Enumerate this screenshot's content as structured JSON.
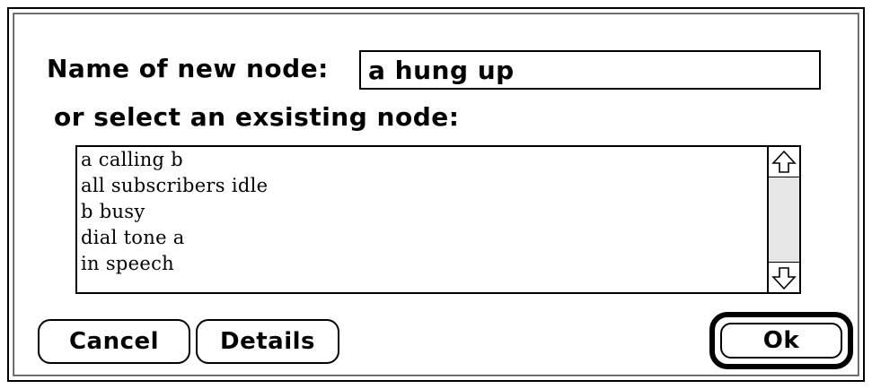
{
  "dialog": {
    "name_label": "Name of new node:",
    "name_value": "a hung up",
    "select_label": "or select an exsisting node:",
    "nodes": [
      "a calling b",
      "all subscribers idle",
      "b busy",
      "dial tone a",
      "in speech"
    ],
    "scroll_up_icon": "up-arrow-icon",
    "scroll_down_icon": "down-arrow-icon",
    "buttons": {
      "cancel": "Cancel",
      "details": "Details",
      "ok": "Ok"
    }
  }
}
